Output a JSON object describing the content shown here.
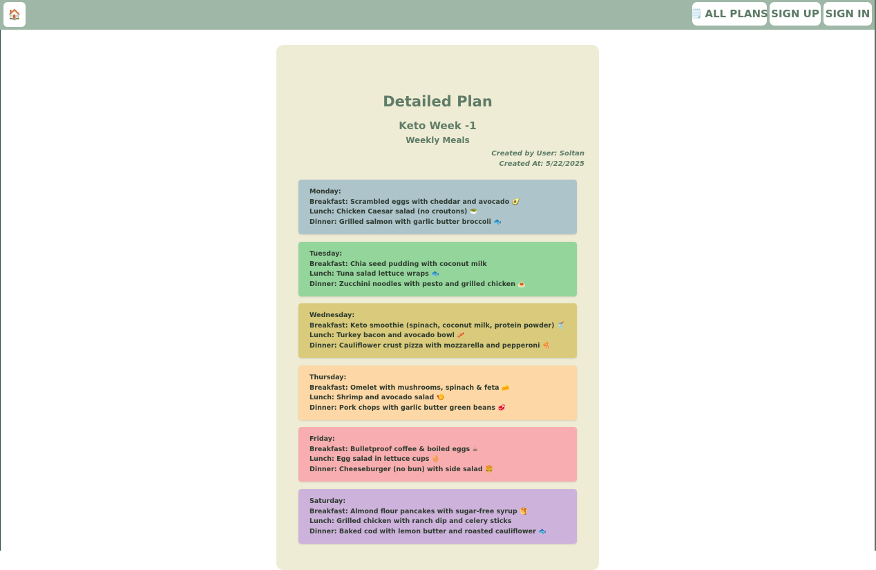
{
  "nav": {
    "home_icon": "🏠",
    "all_plans_icon": "🗒️",
    "all_plans_label": "ALL PLANS",
    "sign_up_label": "SIGN UP",
    "sign_in_label": "SIGN IN"
  },
  "page": {
    "title": "Detailed Plan",
    "plan_name": "Keto Week -1",
    "plan_type": "Weekly Meals",
    "created_by": "Created by User: Soltan",
    "created_at": "Created At: 5/22/2025"
  },
  "days": [
    {
      "day": "Monday:",
      "breakfast": "Breakfast: Scrambled eggs with cheddar and avocado 🥑",
      "lunch": "Lunch: Chicken Caesar salad (no croutons) 🥗",
      "dinner": "Dinner: Grilled salmon with garlic butter broccoli 🐟",
      "color": "#aec4cb"
    },
    {
      "day": "Tuesday:",
      "breakfast": "Breakfast: Chia seed pudding with coconut milk",
      "lunch": "Lunch: Tuna salad lettuce wraps 🐟",
      "dinner": "Dinner: Zucchini noodles with pesto and grilled chicken 🍝",
      "color": "#94d59b"
    },
    {
      "day": "Wednesday:",
      "breakfast": "Breakfast: Keto smoothie (spinach, coconut milk, protein powder) 🥤",
      "lunch": "Lunch: Turkey bacon and avocado bowl 🥓",
      "dinner": "Dinner: Cauliflower crust pizza with mozzarella and pepperoni 🍕",
      "color": "#d9cb7b"
    },
    {
      "day": "Thursday:",
      "breakfast": "Breakfast: Omelet with mushrooms, spinach & feta 🧀",
      "lunch": "Lunch: Shrimp and avocado salad 🍤",
      "dinner": "Dinner: Pork chops with garlic butter green beans 🥩",
      "color": "#fdd7a5"
    },
    {
      "day": "Friday:",
      "breakfast": "Breakfast: Bulletproof coffee & boiled eggs ☕",
      "lunch": "Lunch: Egg salad in lettuce cups 🥚",
      "dinner": "Dinner: Cheeseburger (no bun) with side salad 🍔",
      "color": "#f8aeb0"
    },
    {
      "day": "Saturday:",
      "breakfast": "Breakfast: Almond flour pancakes with sugar-free syrup 🥞",
      "lunch": "Lunch: Grilled chicken with ranch dip and celery sticks",
      "dinner": "Dinner: Baked cod with lemon butter and roasted cauliflower 🐟",
      "color": "#cdb2db"
    }
  ]
}
